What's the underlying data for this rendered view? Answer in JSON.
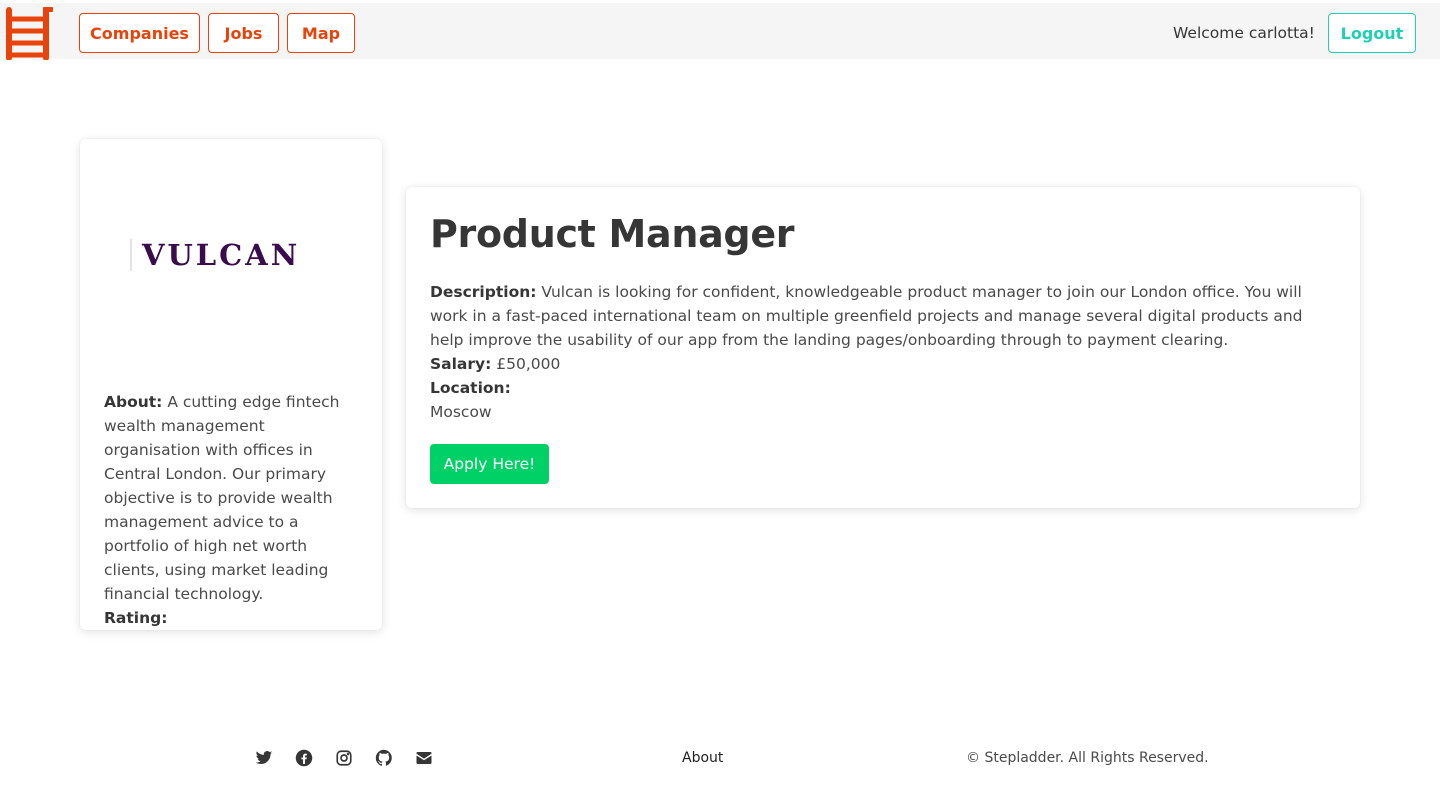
{
  "nav": {
    "logo_icon": "ladder-icon",
    "companies_label": "Companies",
    "jobs_label": "Jobs",
    "map_label": "Map",
    "welcome_text": "Welcome carlotta!",
    "logout_label": "Logout",
    "accent_color": "#e8430b",
    "logout_color": "#1fd1b2"
  },
  "company": {
    "logo_text": "VULCAN",
    "about_label": "About:",
    "about_text": "A cutting edge fintech wealth management organisation with offices in Central London. Our primary objective is to provide wealth management advice to a portfolio of high net worth clients, using market leading financial technology.",
    "rating_label": "Rating:"
  },
  "job": {
    "title": "Product Manager",
    "description_label": "Description:",
    "description_text": "Vulcan is looking for confident, knowledgeable product manager to join our London office. You will work in a fast-paced international team on multiple greenfield projects and manage several digital products and help improve the usability of our app from the landing pages/onboarding through to payment clearing.",
    "salary_label": "Salary:",
    "salary_value": "£50,000",
    "location_label": "Location:",
    "location_value": "Moscow",
    "apply_label": "Apply Here!",
    "apply_color": "#00d167"
  },
  "footer": {
    "icons": [
      "twitter-icon",
      "facebook-icon",
      "instagram-icon",
      "github-icon",
      "envelope-icon"
    ],
    "about_label": "About",
    "copyright": "© Stepladder. All Rights Reserved."
  }
}
